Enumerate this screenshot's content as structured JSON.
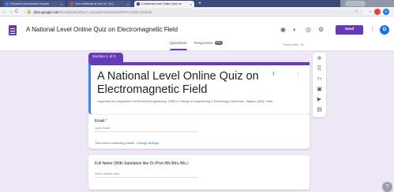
{
  "browser": {
    "tabs": [
      {
        "title": "Firewall Authentication Keepali",
        "favicon_color": "#4285f4",
        "close": "×"
      },
      {
        "title": "Your certificate is here for \"A Q",
        "favicon_color": "#ea4335",
        "close": "×"
      },
      {
        "title": "A National Level Online Quiz on",
        "favicon_color": "#673ab7",
        "close": "×"
      }
    ],
    "new_tab": "+",
    "back": "←",
    "forward": "→",
    "reload": "C",
    "lock": "🔒",
    "url_domain": "docs.google.com",
    "url_path": "/forms/d/1WU0DUt7-yQsxQOC8sfSN1tuNfsfHFSYjRj7LDIc/edit",
    "bookmark": "☆",
    "ext_icons": [
      {
        "name": "extension-icon",
        "glyph": "☆",
        "color": "#9aa0a6"
      },
      {
        "name": "profile-red-icon",
        "glyph": "●",
        "color": "#ea4335"
      },
      {
        "name": "profile-avatar",
        "glyph": "D",
        "color": "#1a73e8"
      }
    ]
  },
  "header": {
    "title": "A National Level Online Quiz on Electromagnetic Field",
    "folder_icon": "🗀",
    "star_icon": "☆",
    "icons": [
      "◉",
      "◐",
      "◎",
      "⚙"
    ],
    "send_label": "Send",
    "more": "⋮",
    "avatar": "D"
  },
  "tabs": {
    "questions": "Questions",
    "responses": "Responses",
    "responses_count": "201"
  },
  "total_points": "Total points: 90",
  "section_label": "Section 1 of 3",
  "form": {
    "title": "A National Level Online Quiz on Electromagnetic Field",
    "description": "Organised by Department of Electrical Engineering, SSBT's College of Engineering & Technology, Bambhori, Jalgaon (MS), India.",
    "collapse_icon": "⁑",
    "more_icon": "⋮"
  },
  "email_question": {
    "label": "Email",
    "required_mark": "*",
    "placeholder": "Valid email",
    "note": "This form is collecting emails.",
    "settings_link": "Change settings"
  },
  "question2": {
    "label": "Full Name (With Salutation like Dr./Prof./Mr./Mrs./Ms.)",
    "placeholder": "Short answer text"
  },
  "toolbar": [
    "⊕",
    "⎘",
    "Tт",
    "▣",
    "▶",
    "▤"
  ],
  "help": "?"
}
